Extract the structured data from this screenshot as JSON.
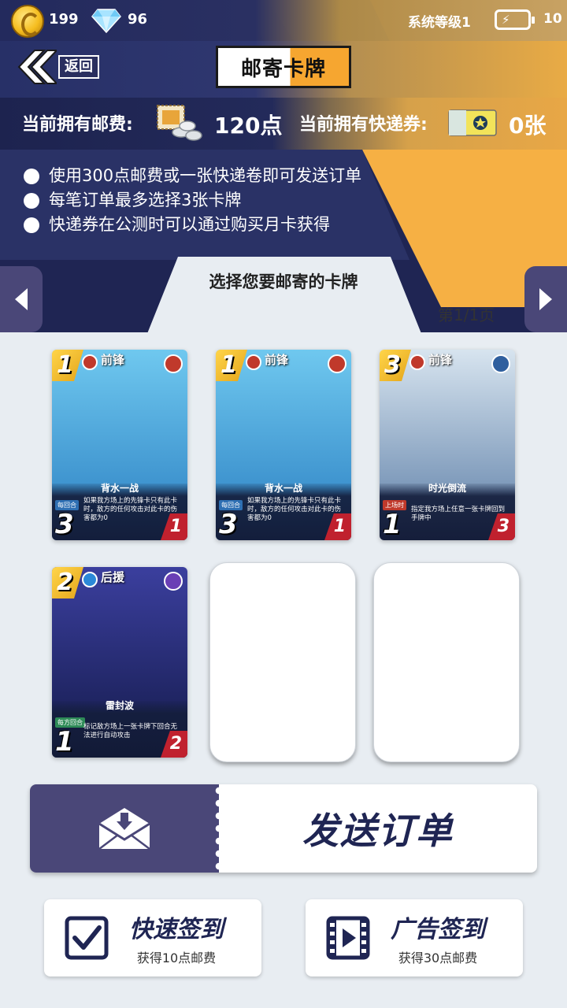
{
  "status": {
    "gold": "199",
    "diamonds": "96",
    "system_level": "系统等级1",
    "energy_icon_text": "⚡",
    "energy": "10"
  },
  "nav": {
    "back_label": "返回",
    "title": "邮寄卡牌"
  },
  "fees": {
    "postage_label": "当前拥有邮费:",
    "postage_value": "120点",
    "express_label": "当前拥有快递券:",
    "express_value": "0张"
  },
  "notes": [
    "使用300点邮费或一张快递卷即可发送订单",
    "每笔订单最多选择3张卡牌",
    "快递券在公测时可以通过购买月卡获得"
  ],
  "selection": {
    "title": "选择您要邮寄的卡牌",
    "page": "第1/1页"
  },
  "cards": [
    {
      "cost": "1",
      "role": "前锋",
      "name": "背水一战",
      "tag": "每回合",
      "desc": "如果我方场上的先锋卡只有此卡时，敌方的任何攻击对此卡的伤害都为0",
      "attack": "3",
      "hp": "1",
      "colors": {
        "art_top": "#6fc8ef",
        "art_bottom": "#2b7fc2",
        "elem": "#c0392b",
        "badge": "#c0392b",
        "tag": "#2e6fb3"
      }
    },
    {
      "cost": "1",
      "role": "前锋",
      "name": "背水一战",
      "tag": "每回合",
      "desc": "如果我方场上的先锋卡只有此卡时，敌方的任何攻击对此卡的伤害都为0",
      "attack": "3",
      "hp": "1",
      "colors": {
        "art_top": "#6fc8ef",
        "art_bottom": "#2b7fc2",
        "elem": "#c0392b",
        "badge": "#c0392b",
        "tag": "#2e6fb3"
      }
    },
    {
      "cost": "3",
      "role": "前锋",
      "name": "时光倒流",
      "tag": "上场时",
      "desc": "指定我方场上任意一张卡牌回到手牌中",
      "attack": "1",
      "hp": "3",
      "colors": {
        "art_top": "#d7e4ef",
        "art_bottom": "#5b7da6",
        "elem": "#c0392b",
        "badge": "#2f5f9e",
        "tag": "#c0392b"
      }
    },
    {
      "cost": "2",
      "role": "后援",
      "name": "雷封波",
      "tag": "每方回合",
      "desc": "标记敌方场上一张卡牌下回合无法进行自动攻击",
      "attack": "1",
      "hp": "2",
      "colors": {
        "art_top": "#3b3f9e",
        "art_bottom": "#141a4a",
        "elem": "#2b88d8",
        "badge": "#6a3fb5",
        "tag": "#2e8b57"
      }
    }
  ],
  "actions": {
    "send_label": "发送订单",
    "quick_signin": {
      "title": "快速签到",
      "subtitle": "获得10点邮费"
    },
    "ad_signin": {
      "title": "广告签到",
      "subtitle": "获得30点邮费"
    }
  },
  "theme": {
    "navy": "#1f2553",
    "orange": "#f6b044",
    "button_purple": "#4a4778"
  }
}
